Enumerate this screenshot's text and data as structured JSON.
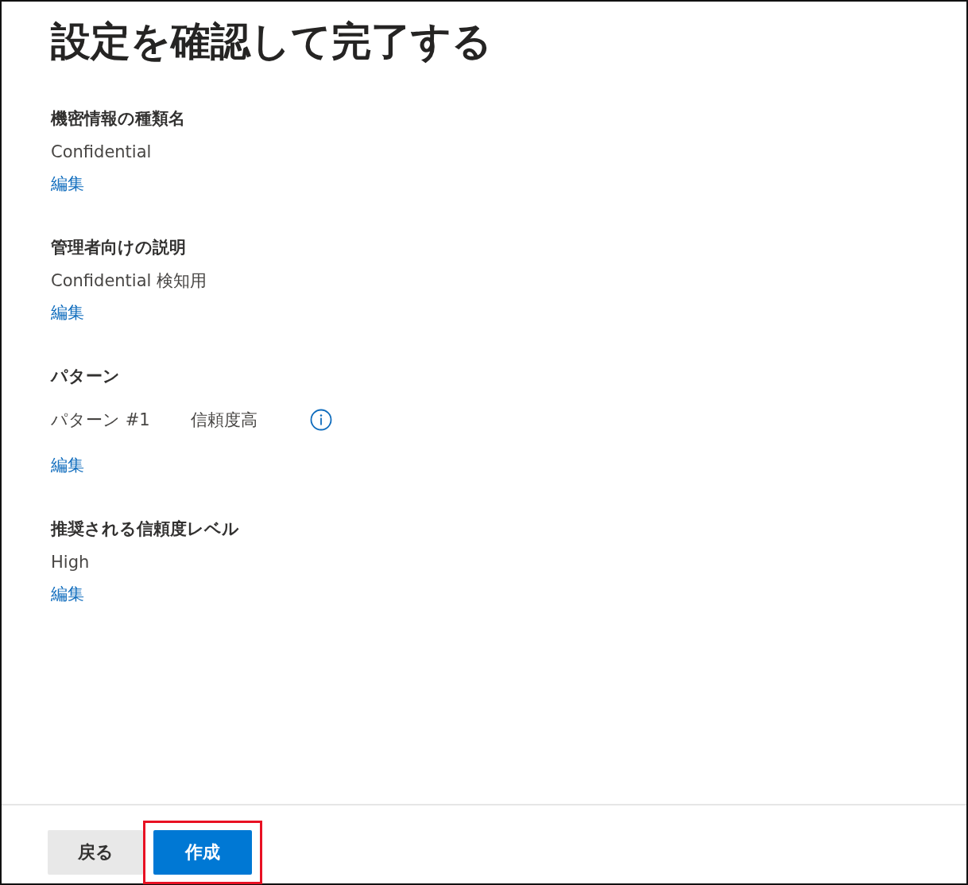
{
  "title": "設定を確認して完了する",
  "sections": [
    {
      "kind": "text",
      "heading": "機密情報の種類名",
      "value": "Confidential",
      "edit": "編集"
    },
    {
      "kind": "text",
      "heading": "管理者向けの説明",
      "value": "Confidential 検知用",
      "edit": "編集"
    },
    {
      "kind": "patterns",
      "heading": "パターン",
      "patterns": [
        {
          "name": "パターン #1",
          "confidence": "信頼度高"
        }
      ],
      "edit": "編集"
    },
    {
      "kind": "text",
      "heading": "推奨される信頼度レベル",
      "value": "High",
      "edit": "編集"
    }
  ],
  "footer": {
    "buttons": [
      {
        "label": "戻る",
        "kind": "secondary",
        "highlighted": false
      },
      {
        "label": "作成",
        "kind": "primary",
        "highlighted": true
      }
    ]
  }
}
